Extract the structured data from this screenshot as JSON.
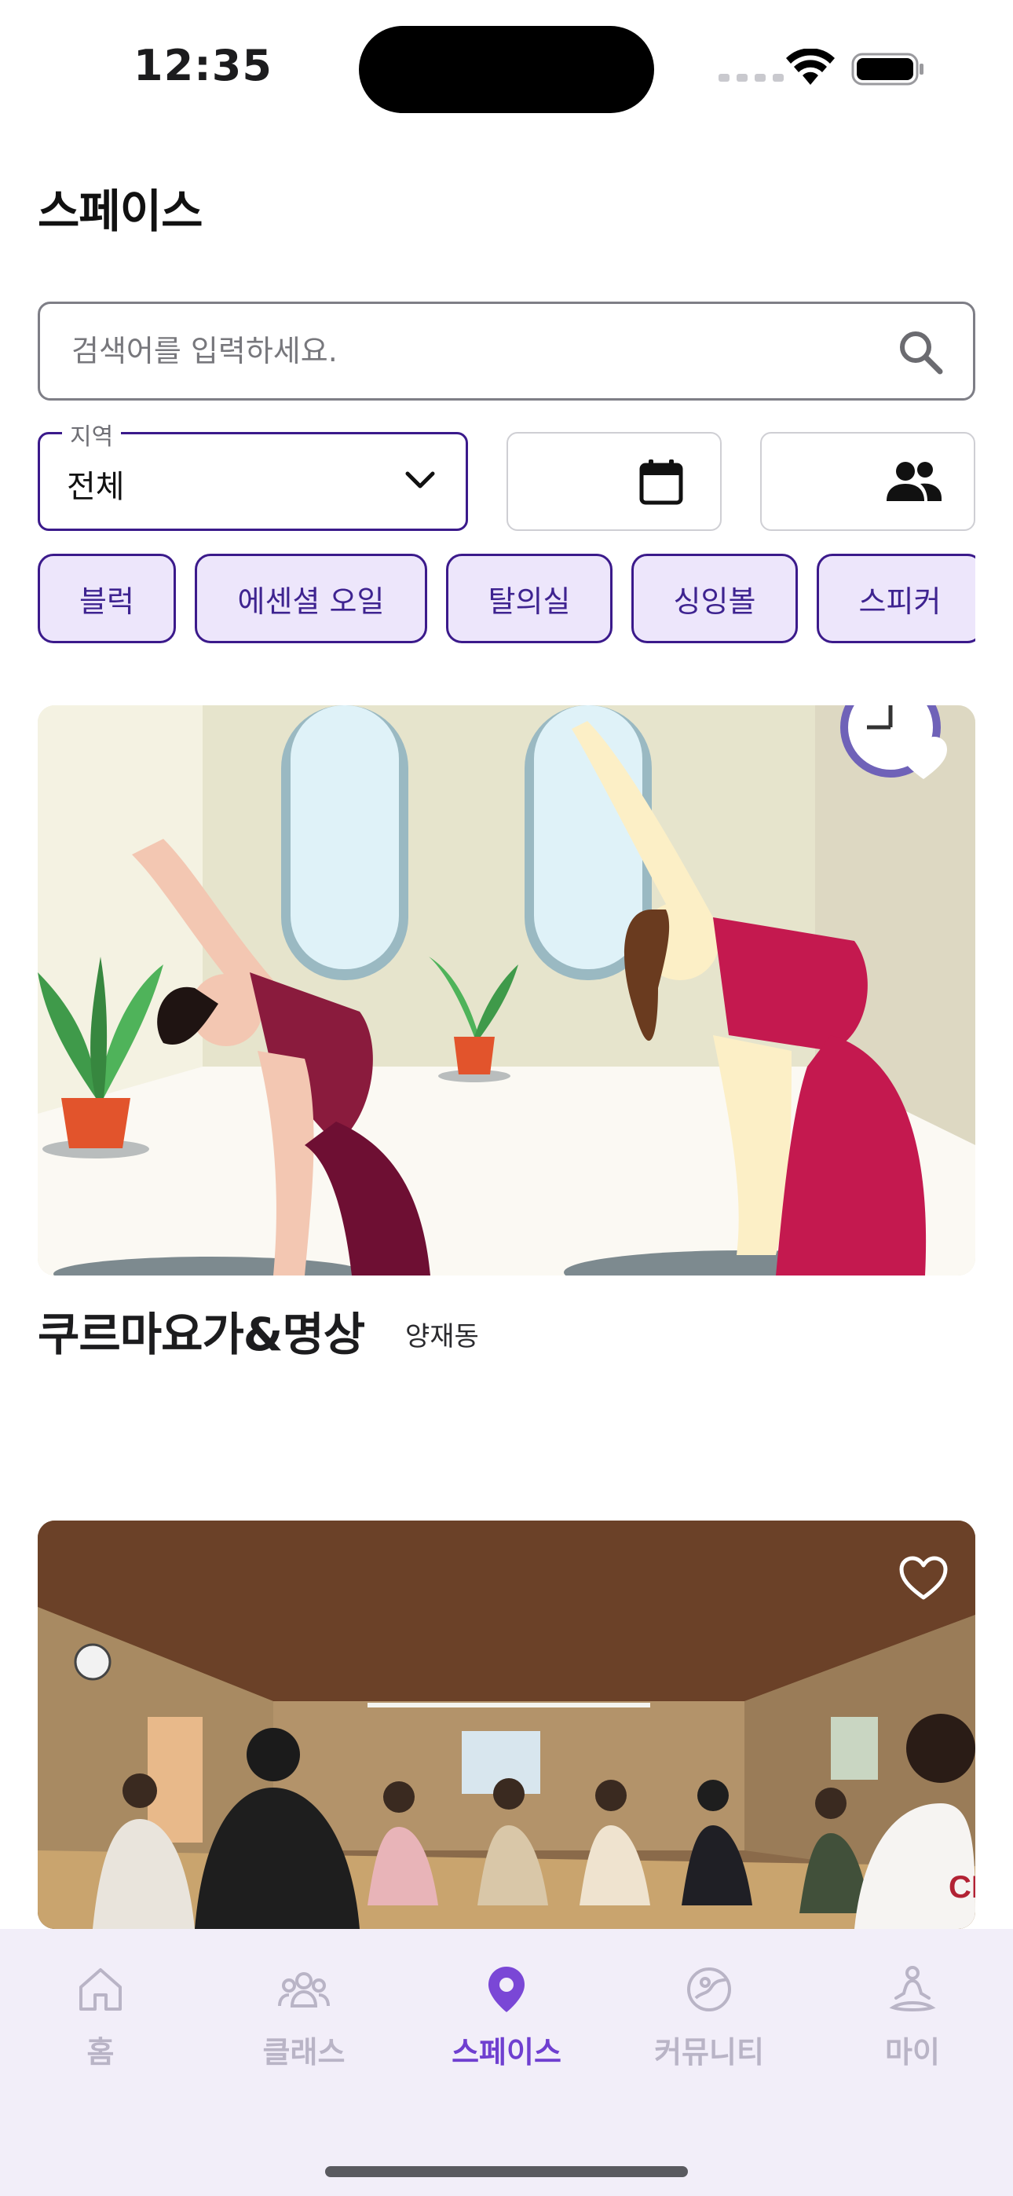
{
  "status_bar": {
    "time": "12:35"
  },
  "header": {
    "title": "스페이스"
  },
  "search": {
    "placeholder": "검색어를 입력하세요.",
    "value": ""
  },
  "filters": {
    "region_label": "지역",
    "region_value": "전체"
  },
  "chips": [
    "블럭",
    "에센셜 오일",
    "탈의실",
    "싱잉볼",
    "스피커"
  ],
  "cards": [
    {
      "title": "쿠르마요가&명상",
      "location": "양재동",
      "liked": false
    },
    {
      "title": "",
      "location": "",
      "liked": false,
      "partial_text": "CHI"
    }
  ],
  "tab_bar": {
    "items": [
      {
        "label": "홈",
        "icon": "home-icon",
        "active": false
      },
      {
        "label": "클래스",
        "icon": "group-icon",
        "active": false
      },
      {
        "label": "스페이스",
        "icon": "location-pin-icon",
        "active": true
      },
      {
        "label": "커뮤니티",
        "icon": "community-icon",
        "active": false
      },
      {
        "label": "마이",
        "icon": "meditation-person-icon",
        "active": false
      }
    ]
  },
  "colors": {
    "accent": "#6f3fd0",
    "chip_border": "#3b1a8b",
    "chip_bg": "#ede6fb",
    "tab_bg": "#f2eef9",
    "tab_inactive": "#b9b4c6"
  }
}
